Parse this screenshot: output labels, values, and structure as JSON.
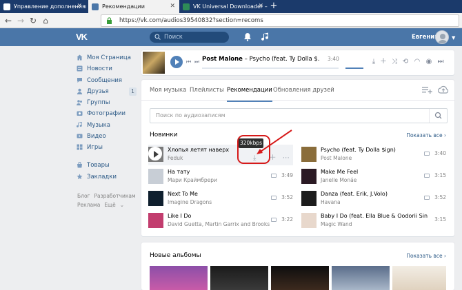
{
  "browser": {
    "tabs": [
      {
        "label": "Управление дополнениями"
      },
      {
        "label": "Рекомендации"
      },
      {
        "label": "VK Universal Downloader – Доп"
      }
    ],
    "new_tab": "+",
    "url": "https://vk.com/audios39540832?section=recoms"
  },
  "vk": {
    "logo": "VK",
    "search_placeholder": "Поиск",
    "user_name": "Евгений"
  },
  "menu": {
    "items": [
      {
        "label": "Моя Страница",
        "icon": "home-icon"
      },
      {
        "label": "Новости",
        "icon": "news-icon"
      },
      {
        "label": "Сообщения",
        "icon": "messages-icon"
      },
      {
        "label": "Друзья",
        "icon": "friends-icon",
        "badge": "1"
      },
      {
        "label": "Группы",
        "icon": "groups-icon"
      },
      {
        "label": "Фотографии",
        "icon": "photos-icon"
      },
      {
        "label": "Музыка",
        "icon": "music-icon"
      },
      {
        "label": "Видео",
        "icon": "video-icon"
      },
      {
        "label": "Игры",
        "icon": "games-icon"
      },
      {
        "label": "Товары",
        "icon": "goods-icon"
      },
      {
        "label": "Закладки",
        "icon": "bookmarks-icon"
      }
    ],
    "footer": [
      "Блог",
      "Разработчикам",
      "Реклама",
      "Ещё"
    ]
  },
  "player": {
    "artist": "Post Malone",
    "title": " – Psycho (feat. Ty Dolla $...",
    "time": "3:40"
  },
  "tabs": [
    "Моя музыка",
    "Плейлисты",
    "Рекомендации",
    "Обновления друзей"
  ],
  "active_tab": "Рекомендации",
  "search_placeholder": "Поиск по аудиозаписям",
  "sections": {
    "new_title": "Новинки",
    "show_all": "Показать все",
    "albums_title": "Новые альбомы"
  },
  "tooltip": "320kbps",
  "tracks_left": [
    {
      "title": "Хлопья летят наверх",
      "artist": "Feduk",
      "duration": "",
      "cover": "#7a7a7a"
    },
    {
      "title": "На тату",
      "artist": "Мари Краймбрери",
      "duration": "3:49",
      "cover": "#c8ced6"
    },
    {
      "title": "Next To Me",
      "artist": "Imagine Dragons",
      "duration": "3:52",
      "cover": "#0f1f2e"
    },
    {
      "title": "Like I Do",
      "artist": "David Guetta, Martin Garrix and Brooks",
      "duration": "3:22",
      "cover": "#c23d6e"
    }
  ],
  "tracks_right": [
    {
      "title": "Psycho (feat. Ty Dolla $ign)",
      "artist": "Post Malone",
      "duration": "3:40",
      "cover": "#8a6d3b"
    },
    {
      "title": "Make Me Feel",
      "artist": "Janelle Monáe",
      "duration": "3:15",
      "cover": "#2b1a24"
    },
    {
      "title": "Danza (feat. Erik, J.Volo)",
      "artist": "Havana",
      "duration": "3:52",
      "cover": "#1c1c1c"
    },
    {
      "title": "Baby I Do (feat. Ella Blue & Oodorii Sin)",
      "artist": "Magic Wand",
      "duration": "3:15",
      "cover": "#e8d8cc"
    }
  ],
  "colors": {
    "vk_blue": "#4a76a8",
    "link": "#2a5885",
    "annotation_red": "#d61a1a"
  }
}
